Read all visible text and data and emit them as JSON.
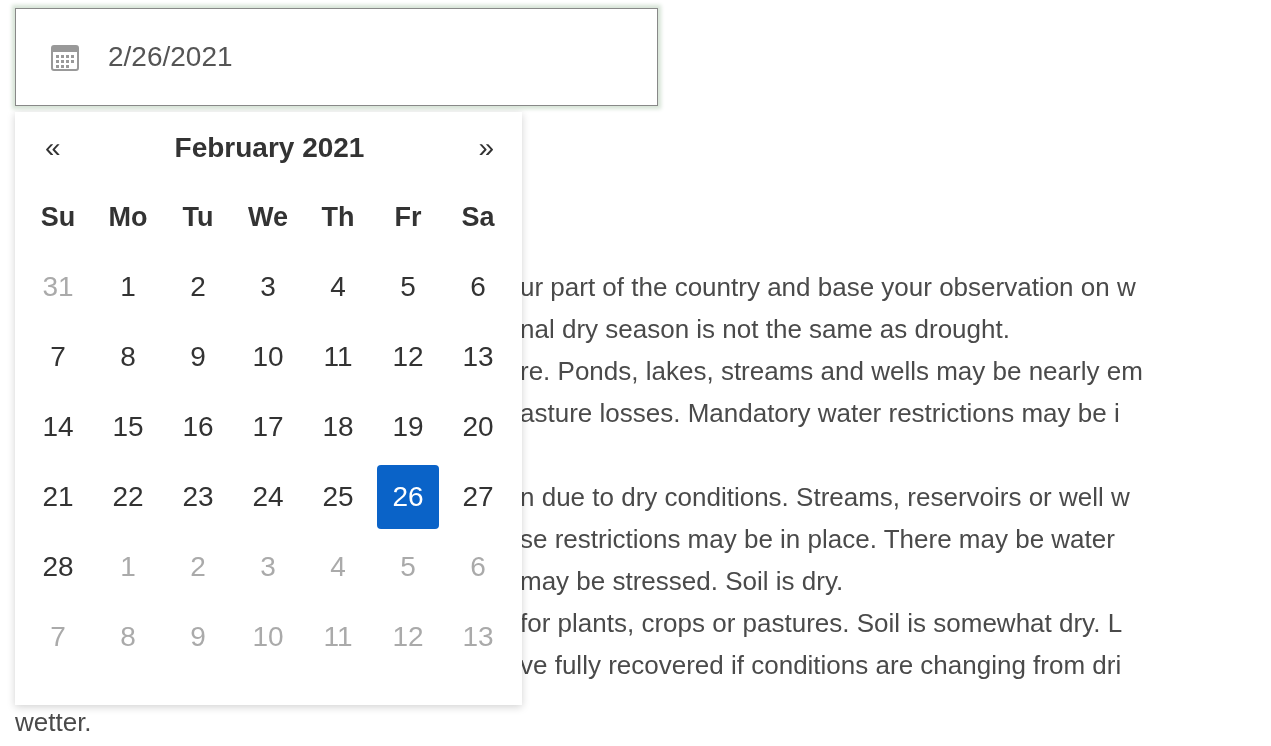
{
  "date_field": {
    "value": "2/26/2021"
  },
  "calendar": {
    "prev": "«",
    "title": "February 2021",
    "next": "»",
    "weekdays": [
      "Su",
      "Mo",
      "Tu",
      "We",
      "Th",
      "Fr",
      "Sa"
    ],
    "weeks": [
      [
        {
          "day": "31",
          "muted": true,
          "selected": false
        },
        {
          "day": "1",
          "muted": false,
          "selected": false
        },
        {
          "day": "2",
          "muted": false,
          "selected": false
        },
        {
          "day": "3",
          "muted": false,
          "selected": false
        },
        {
          "day": "4",
          "muted": false,
          "selected": false
        },
        {
          "day": "5",
          "muted": false,
          "selected": false
        },
        {
          "day": "6",
          "muted": false,
          "selected": false
        }
      ],
      [
        {
          "day": "7",
          "muted": false,
          "selected": false
        },
        {
          "day": "8",
          "muted": false,
          "selected": false
        },
        {
          "day": "9",
          "muted": false,
          "selected": false
        },
        {
          "day": "10",
          "muted": false,
          "selected": false
        },
        {
          "day": "11",
          "muted": false,
          "selected": false
        },
        {
          "day": "12",
          "muted": false,
          "selected": false
        },
        {
          "day": "13",
          "muted": false,
          "selected": false
        }
      ],
      [
        {
          "day": "14",
          "muted": false,
          "selected": false
        },
        {
          "day": "15",
          "muted": false,
          "selected": false
        },
        {
          "day": "16",
          "muted": false,
          "selected": false
        },
        {
          "day": "17",
          "muted": false,
          "selected": false
        },
        {
          "day": "18",
          "muted": false,
          "selected": false
        },
        {
          "day": "19",
          "muted": false,
          "selected": false
        },
        {
          "day": "20",
          "muted": false,
          "selected": false
        }
      ],
      [
        {
          "day": "21",
          "muted": false,
          "selected": false
        },
        {
          "day": "22",
          "muted": false,
          "selected": false
        },
        {
          "day": "23",
          "muted": false,
          "selected": false
        },
        {
          "day": "24",
          "muted": false,
          "selected": false
        },
        {
          "day": "25",
          "muted": false,
          "selected": false
        },
        {
          "day": "26",
          "muted": false,
          "selected": true
        },
        {
          "day": "27",
          "muted": false,
          "selected": false
        }
      ],
      [
        {
          "day": "28",
          "muted": false,
          "selected": false
        },
        {
          "day": "1",
          "muted": true,
          "selected": false
        },
        {
          "day": "2",
          "muted": true,
          "selected": false
        },
        {
          "day": "3",
          "muted": true,
          "selected": false
        },
        {
          "day": "4",
          "muted": true,
          "selected": false
        },
        {
          "day": "5",
          "muted": true,
          "selected": false
        },
        {
          "day": "6",
          "muted": true,
          "selected": false
        }
      ],
      [
        {
          "day": "7",
          "muted": true,
          "selected": false
        },
        {
          "day": "8",
          "muted": true,
          "selected": false
        },
        {
          "day": "9",
          "muted": true,
          "selected": false
        },
        {
          "day": "10",
          "muted": true,
          "selected": false
        },
        {
          "day": "11",
          "muted": true,
          "selected": false
        },
        {
          "day": "12",
          "muted": true,
          "selected": false
        },
        {
          "day": "13",
          "muted": true,
          "selected": false
        }
      ]
    ]
  },
  "paragraph_groups": [
    [
      "ur part of the country and base your observation on w",
      "nal dry season is not the same as drought.",
      "re. Ponds, lakes, streams and wells may be nearly em",
      "asture losses. Mandatory water restrictions may be i"
    ],
    [
      "n due to dry conditions. Streams, reservoirs or well w",
      "se restrictions may be in place. There may be water",
      "may be stressed. Soil is dry.",
      "for plants, crops or pastures. Soil is somewhat dry. L",
      "ve fully recovered if conditions are changing from dri"
    ]
  ],
  "last_line": "wetter."
}
